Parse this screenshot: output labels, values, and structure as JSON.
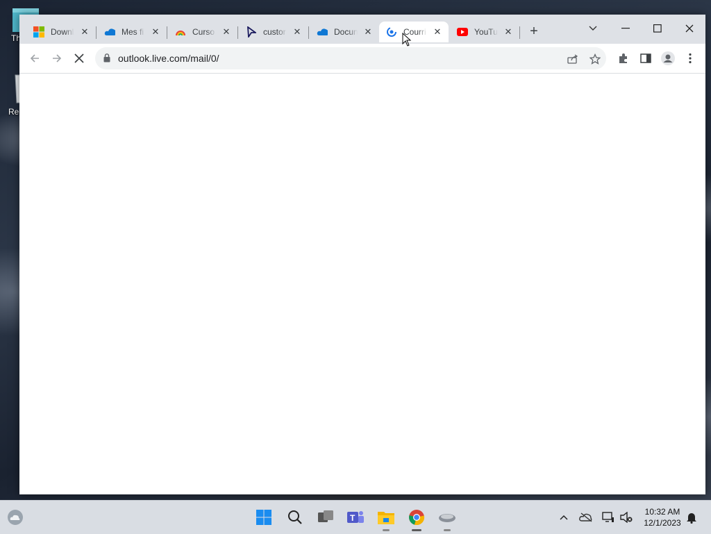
{
  "desktop": {
    "icons": [
      {
        "label": "Th",
        "icon": "folder-icon"
      },
      {
        "label": "Rec",
        "icon": "recycle-bin-icon"
      }
    ]
  },
  "browser": {
    "tabs": [
      {
        "title": "Downl",
        "icon": "microsoft-logo-icon",
        "active": false
      },
      {
        "title": "Mes fi",
        "icon": "onedrive-icon",
        "active": false
      },
      {
        "title": "Curso",
        "icon": "rainbow-icon",
        "active": false
      },
      {
        "title": "custor",
        "icon": "cursor-arrow-icon",
        "active": false
      },
      {
        "title": "Docun",
        "icon": "onedrive-icon",
        "active": false
      },
      {
        "title": "Courri",
        "icon": "outlook-loading-icon",
        "active": true
      },
      {
        "title": "YouTu",
        "icon": "youtube-icon",
        "active": false
      }
    ],
    "url": "outlook.live.com/mail/0/",
    "loading": true
  },
  "taskbar": {
    "apps": [
      "start-icon",
      "search-icon",
      "task-view-icon",
      "teams-icon",
      "file-explorer-icon",
      "chrome-icon",
      "mouse-app-icon"
    ],
    "active_app": "chrome-icon",
    "clock": {
      "time": "10:32 AM",
      "date": "12/1/2023"
    }
  },
  "colors": {
    "tabstrip": "#dee1e6",
    "omnibox": "#f1f3f4",
    "taskbar": "#d9dde3"
  }
}
